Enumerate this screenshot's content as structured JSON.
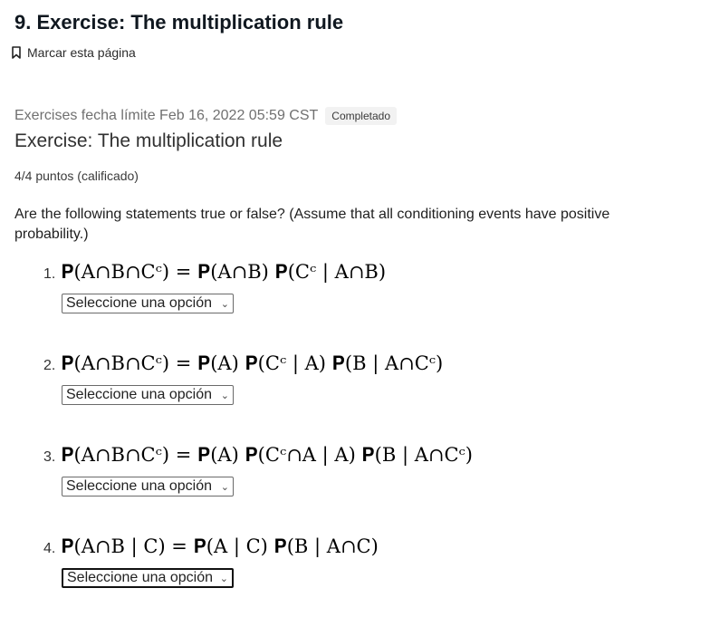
{
  "header": {
    "title": "9. Exercise: The multiplication rule",
    "bookmark_label": "Marcar esta página"
  },
  "problem": {
    "due_text": "Exercises fecha límite Feb 16, 2022 05:59 CST",
    "status_badge": "Completado",
    "title": "Exercise: The multiplication rule",
    "score": "4/4 puntos (calificado)",
    "prompt": "Are the following statements true or false? (Assume that all conditioning events have positive probability.)"
  },
  "questions": [
    {
      "number": "1.",
      "formula": "𝐏(A∩B∩Cᶜ) = 𝐏(A∩B) 𝐏(Cᶜ | A∩B)",
      "select_value": "Seleccione una opción"
    },
    {
      "number": "2.",
      "formula": "𝐏(A∩B∩Cᶜ) = 𝐏(A) 𝐏(Cᶜ | A) 𝐏(B | A∩Cᶜ)",
      "select_value": "Seleccione una opción"
    },
    {
      "number": "3.",
      "formula": "𝐏(A∩B∩Cᶜ) = 𝐏(A) 𝐏(Cᶜ∩A | A) 𝐏(B | A∩Cᶜ)",
      "select_value": "Seleccione una opción"
    },
    {
      "number": "4.",
      "formula": "𝐏(A∩B | C) = 𝐏(A | C) 𝐏(B | A∩C)",
      "select_value": "Seleccione una opción"
    }
  ],
  "icons": {
    "bookmark": "bookmark-icon",
    "dropdown": "chevron-down-icon"
  }
}
